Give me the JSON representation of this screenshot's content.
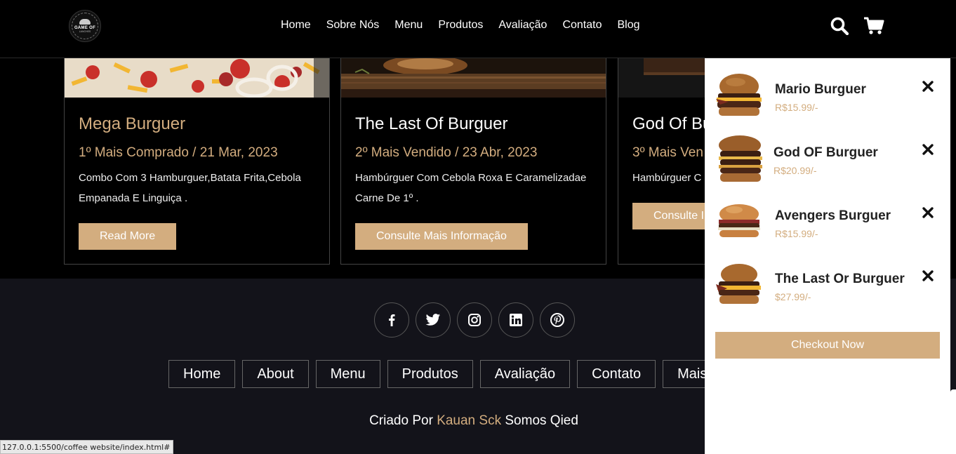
{
  "logo": {
    "line1": "GAME OF",
    "line2": "LANCHES"
  },
  "nav": [
    "Home",
    "Sobre Nós",
    "Menu",
    "Produtos",
    "Avaliação",
    "Contato",
    "Blog"
  ],
  "header_icons": [
    "search-icon",
    "cart-icon"
  ],
  "cards": [
    {
      "title": "Mega Burguer",
      "meta": "1º Mais Comprado / 21 Mar, 2023",
      "desc": "Combo Com 3 Hamburguer,Batata Frita,Cebola Empanada E Linguiça .",
      "button": "Read More"
    },
    {
      "title": "The Last Of Burguer",
      "meta": "2º Mais Vendido / 23 Abr, 2023",
      "desc": "Hambúrguer Com Cebola Roxa E Caramelizadae Carne De 1º .",
      "button": "Consulte Mais Informação"
    },
    {
      "title": "God Of Bu",
      "meta": "3º Mais Ven",
      "desc": "Hambúrguer C",
      "button": "Consulte I"
    }
  ],
  "footer": {
    "socials": [
      "facebook-icon",
      "twitter-icon",
      "instagram-icon",
      "linkedin-icon",
      "pinterest-icon"
    ],
    "links": [
      "Home",
      "About",
      "Menu",
      "Produtos",
      "Avaliação",
      "Contato",
      "Mais"
    ],
    "credit_prefix": "Criado Por",
    "credit_name": "Kauan Sck",
    "credit_suffix": "Somos Qied"
  },
  "cart": {
    "items": [
      {
        "name": "Mario Burguer",
        "price": "R$15.99/-"
      },
      {
        "name": "God OF Burguer",
        "price": "R$20.99/-"
      },
      {
        "name": "Avengers Burguer",
        "price": "R$15.99/-"
      },
      {
        "name": "The Last Or Burguer",
        "price": "$27.99/-"
      }
    ],
    "checkout": "Checkout Now"
  },
  "status_url": "127.0.0.1:5500/coffee website/index.html#",
  "colors": {
    "accent": "#d3ad7f",
    "background": "#000000",
    "footer": "#13131a"
  }
}
